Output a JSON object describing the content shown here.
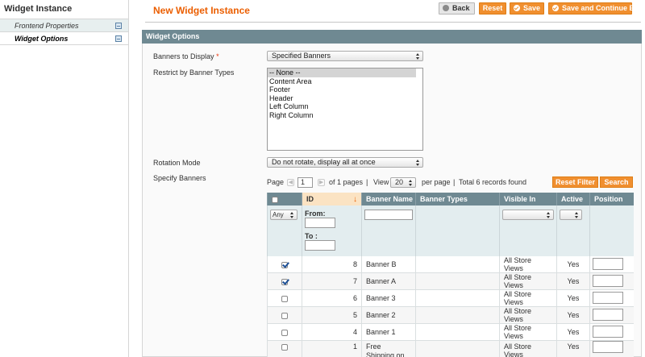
{
  "sidebar": {
    "title": "Widget Instance",
    "items": [
      {
        "label": "Frontend Properties",
        "icon": "collapse-icon"
      },
      {
        "label": "Widget Options",
        "icon": "collapse-icon"
      }
    ]
  },
  "header": {
    "title": "New Widget Instance",
    "buttons": {
      "back": "Back",
      "reset": "Reset",
      "save": "Save",
      "save_continue": "Save and Continue Edit"
    }
  },
  "section": {
    "title": "Widget Options"
  },
  "form": {
    "banners_to_display": {
      "label": "Banners to Display",
      "required": "*",
      "value": "Specified Banners"
    },
    "restrict_types": {
      "label": "Restrict by Banner Types",
      "options": [
        "-- None --",
        "Content Area",
        "Footer",
        "Header",
        "Left Column",
        "Right Column"
      ]
    },
    "rotation_mode": {
      "label": "Rotation Mode",
      "value": "Do not rotate, display all at once"
    },
    "specify_banners": {
      "label": "Specify Banners"
    }
  },
  "pager": {
    "page_label": "Page",
    "page_value": "1",
    "of_pages": "of 1 pages",
    "sep1": "|",
    "view_label": "View",
    "view_value": "20",
    "per_page": "per page",
    "sep2": "|",
    "total": "Total 6 records found",
    "reset_filter": "Reset Filter",
    "search": "Search"
  },
  "grid": {
    "columns": [
      "ID",
      "Banner Name",
      "Banner Types",
      "Visible In",
      "Active",
      "Position"
    ],
    "sort_arrow": "↓",
    "filter": {
      "any": "Any",
      "from": "From:",
      "to": "To :"
    },
    "rows": [
      {
        "checked": true,
        "id": "8",
        "name": "Banner B",
        "types": "",
        "visible": "All Store Views",
        "active": "Yes"
      },
      {
        "checked": true,
        "id": "7",
        "name": "Banner A",
        "types": "",
        "visible": "All Store Views",
        "active": "Yes"
      },
      {
        "checked": false,
        "id": "6",
        "name": "Banner 3",
        "types": "",
        "visible": "All Store Views",
        "active": "Yes"
      },
      {
        "checked": false,
        "id": "5",
        "name": "Banner 2",
        "types": "",
        "visible": "All Store Views",
        "active": "Yes"
      },
      {
        "checked": false,
        "id": "4",
        "name": "Banner 1",
        "types": "",
        "visible": "All Store Views",
        "active": "Yes"
      },
      {
        "checked": false,
        "id": "1",
        "name": "Free Shipping on All Handbags",
        "types": "",
        "visible": "All Store Views",
        "active": "Yes"
      }
    ]
  },
  "colors": {
    "accent": "#eb5e00",
    "button": "#f08f2f",
    "section_bar": "#6f8992"
  }
}
